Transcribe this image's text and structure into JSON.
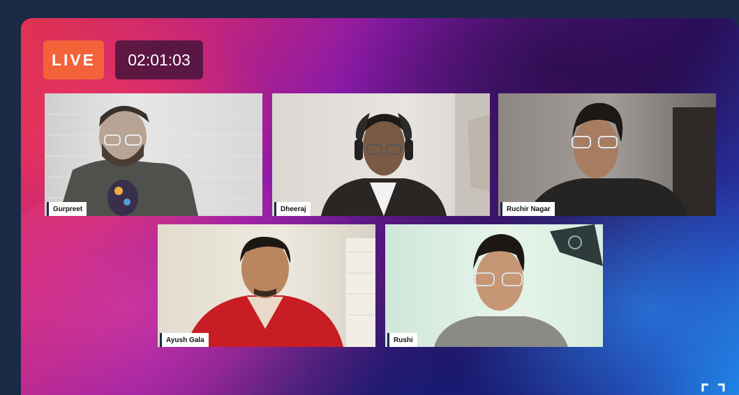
{
  "stream": {
    "live_label": "LIVE",
    "elapsed": "02:01:03"
  },
  "participants": [
    {
      "name": "Gurpreet"
    },
    {
      "name": "Dheeraj"
    },
    {
      "name": "Ruchir Nagar"
    },
    {
      "name": "Ayush Gala"
    },
    {
      "name": "Rushi"
    }
  ],
  "colors": {
    "live_accent": "#f4623a",
    "timer_bg": "#46143c",
    "page_bg": "#1b2a47"
  },
  "icons": {
    "fullscreen": "fullscreen-icon"
  }
}
